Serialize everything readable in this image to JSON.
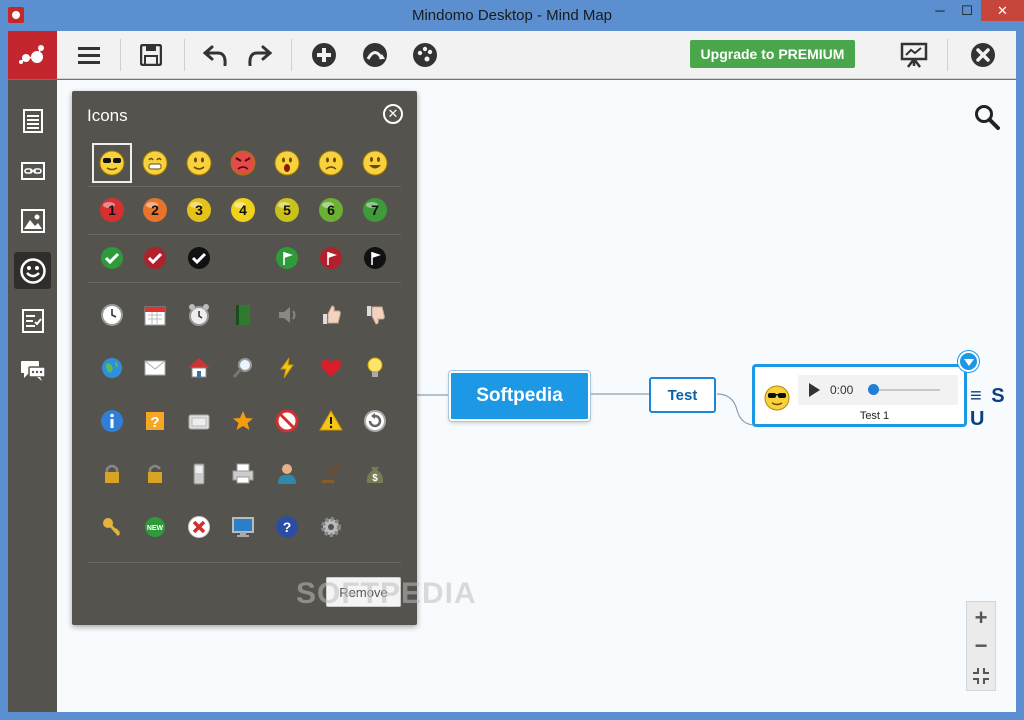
{
  "window": {
    "title": "Mindomo Desktop - Mind Map",
    "minimize": "─",
    "maximize": "☐",
    "close": "✕"
  },
  "toolbar": {
    "upgrade_label": "Upgrade to PREMIUM"
  },
  "icons_panel": {
    "title": "Icons",
    "close_glyph": "✕",
    "remove_label": "Remove",
    "rows": [
      [
        "emoji-cool",
        "emoji-grin",
        "emoji-smile",
        "emoji-angry",
        "emoji-surprised",
        "emoji-sad",
        "emoji-happy"
      ],
      [
        "priority-1",
        "priority-2",
        "priority-3",
        "priority-4",
        "priority-5",
        "priority-6",
        "priority-7"
      ],
      [
        "check-green",
        "check-red",
        "check-black",
        "",
        "flag-green",
        "flag-red",
        "flag-black"
      ],
      [
        "clock",
        "calendar",
        "alarm-clock",
        "book",
        "speaker",
        "thumbs-up",
        "thumbs-down"
      ],
      [
        "globe",
        "envelope",
        "house",
        "magnifier",
        "lightning",
        "heart",
        "lightbulb"
      ],
      [
        "info",
        "question-box",
        "tv",
        "star",
        "forbidden",
        "warning",
        "refresh"
      ],
      [
        "lock",
        "unlock",
        "phone",
        "printer",
        "person",
        "gavel",
        "money-bag"
      ],
      [
        "key",
        "new-badge",
        "cross",
        "monitor",
        "help",
        "gear"
      ]
    ]
  },
  "map": {
    "central_node": "Softpedia",
    "child_node": "Test",
    "media_node": {
      "time": "0:00",
      "label": "Test 1"
    },
    "trailing_node": "≡ S U"
  },
  "watermark": "SOFTPEDIA",
  "zoom": {
    "in": "+",
    "out": "−"
  },
  "colors": {
    "accent": "#1d98e5",
    "brand": "#c4262e",
    "upgrade": "#4aa64a",
    "panel": "#55534e"
  }
}
